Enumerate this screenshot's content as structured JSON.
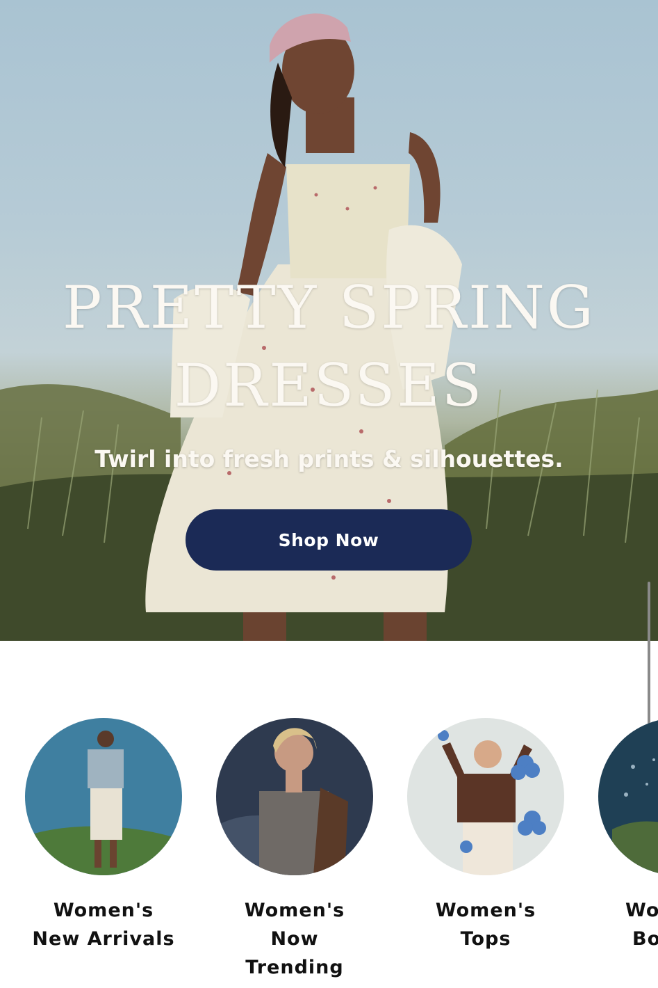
{
  "hero": {
    "title_line1": "PRETTY SPRING",
    "title_line2": "DRESSES",
    "subtitle": "Twirl into fresh prints & silhouettes.",
    "cta_label": "Shop Now",
    "cta_color": "#1b2a56"
  },
  "categories": [
    {
      "line1": "Women's",
      "line2": "New Arrivals",
      "line3": ""
    },
    {
      "line1": "Women's",
      "line2": "Now",
      "line3": "Trending"
    },
    {
      "line1": "Women's",
      "line2": "Tops",
      "line3": ""
    },
    {
      "line1": "Wo",
      "line2": "Bo",
      "line3": ""
    }
  ]
}
